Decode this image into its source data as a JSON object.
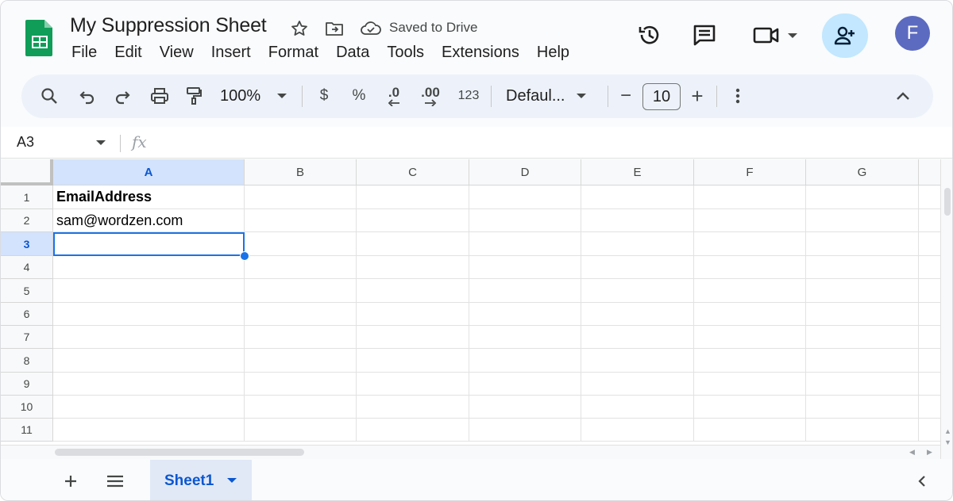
{
  "document": {
    "title": "My Suppression Sheet",
    "save_status": "Saved to Drive"
  },
  "menu": [
    "File",
    "Edit",
    "View",
    "Insert",
    "Format",
    "Data",
    "Tools",
    "Extensions",
    "Help"
  ],
  "header_icons": {
    "star": "star-icon",
    "move": "move-to-folder-icon",
    "cloud": "cloud-saved-icon",
    "history": "version-history-icon",
    "comments": "comments-icon",
    "meet": "video-call-icon",
    "share": "add-person-icon"
  },
  "user": {
    "avatar_letter": "F",
    "avatar_color": "#5c6bc0"
  },
  "toolbar": {
    "zoom": "100%",
    "currency": "$",
    "percent": "%",
    "decrease_decimals": ".0",
    "increase_decimals": ".00",
    "number_format": "123",
    "font": "Defaul...",
    "font_size": "10",
    "minus": "−",
    "plus": "+"
  },
  "formula_bar": {
    "cell_ref": "A3",
    "fx": "fx",
    "value": ""
  },
  "grid": {
    "columns": [
      "A",
      "B",
      "C",
      "D",
      "E",
      "F",
      "G"
    ],
    "rows": [
      "1",
      "2",
      "3",
      "4",
      "5",
      "6",
      "7",
      "8",
      "9",
      "10",
      "11"
    ],
    "cells": {
      "A1": "EmailAddress",
      "A2": "sam@wordzen.com"
    },
    "selected_cell": "A3"
  },
  "sheets": {
    "active": "Sheet1",
    "add_label": "+",
    "list_label": "≡"
  },
  "colors": {
    "accent": "#0b57d0",
    "selection": "#1a73e8",
    "header_selected": "#d3e3fd",
    "toolbar_bg": "#edf2fa",
    "share_bg": "#c2e7ff",
    "sheets_green": "#0f9d58"
  }
}
